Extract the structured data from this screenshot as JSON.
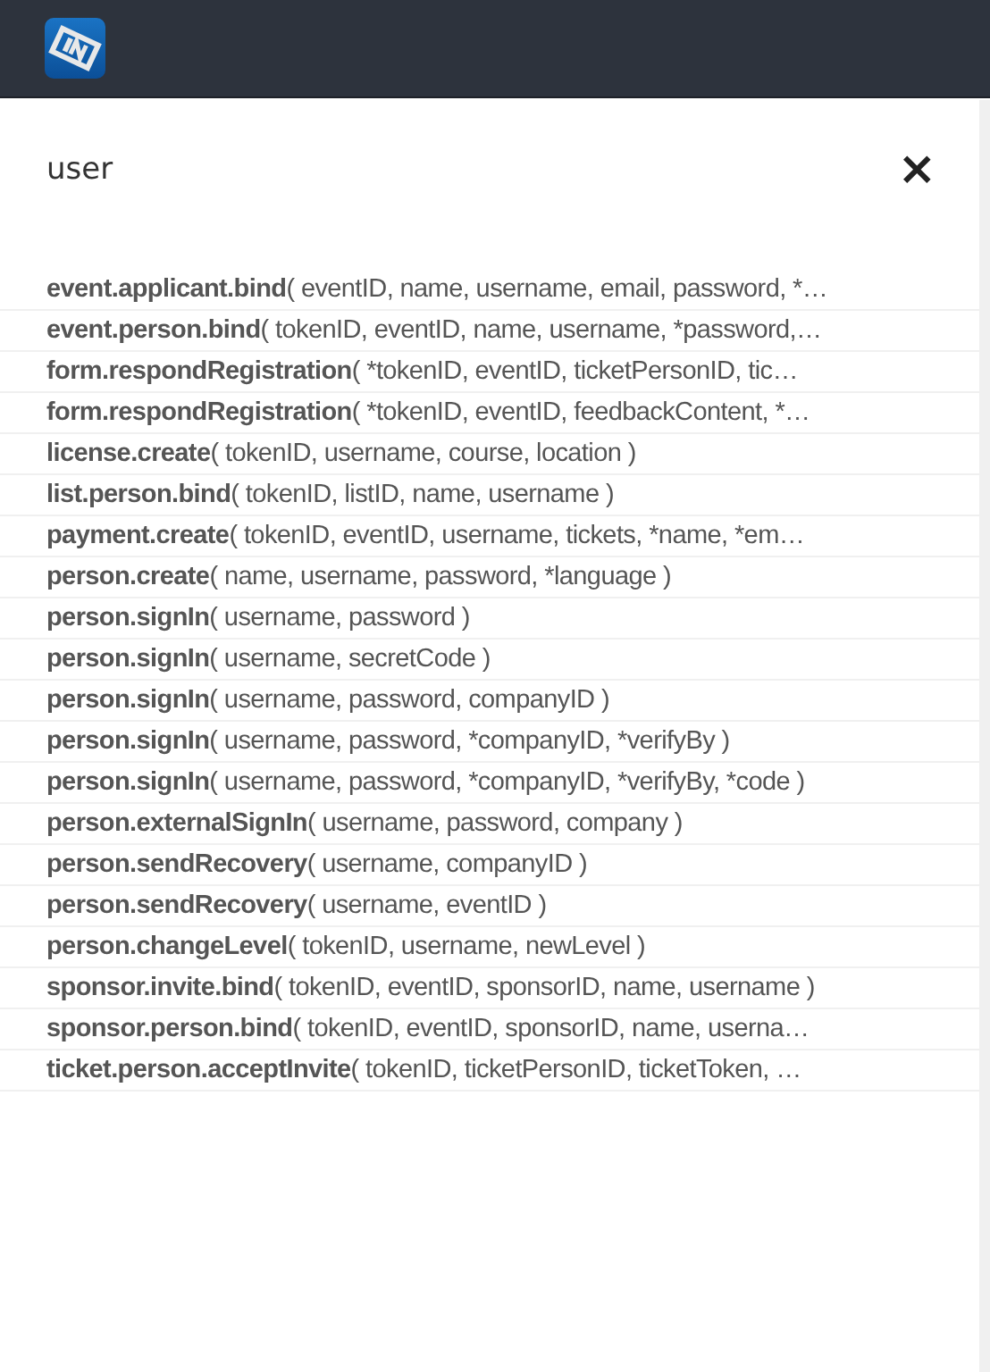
{
  "header": {
    "logo": {
      "kind": "logo"
    }
  },
  "search": {
    "value": "user",
    "close": "×"
  },
  "results": [
    {
      "text": "**event.applicant.bind**( eventID, name, username, email, password, *…"
    },
    {
      "text": "**event.person.bind**( tokenID, eventID, name, username, *password,…"
    },
    {
      "text": "**form.respondRegistration**( *tokenID, eventID, ticketPersonID, tic…"
    },
    {
      "text": "**form.respondRegistration**( *tokenID, eventID, feedbackContent, *…"
    },
    {
      "text": "**license.create**( tokenID, username, course, location )"
    },
    {
      "text": "**list.person.bind**( tokenID, listID, name, username )"
    },
    {
      "text": "**payment.create**( tokenID, eventID, username, tickets, *name, *em…"
    },
    {
      "text": "**person.create**( name, username, password, *language )"
    },
    {
      "text": "**person.signIn**( username, password )"
    },
    {
      "text": "**person.signIn**( username, secretCode )"
    },
    {
      "text": "**person.signIn**( username, password, companyID )"
    },
    {
      "text": "**person.signIn**( username, password, *companyID, *verifyBy )"
    },
    {
      "text": "**person.signIn**( username, password, *companyID, *verifyBy, *code )"
    },
    {
      "text": "**person.externalSignIn**( username, password, company )"
    },
    {
      "text": "**person.sendRecovery**( username, companyID )"
    },
    {
      "text": "**person.sendRecovery**( username, eventID )"
    },
    {
      "text": "**person.changeLevel**( tokenID, username, newLevel )"
    },
    {
      "text": "**sponsor.invite.bind**( tokenID, eventID, sponsorID, name, username )"
    },
    {
      "text": "**sponsor.person.bind**( tokenID, eventID, sponsorID, name, userna…"
    },
    {
      "text": "**ticket.person.acceptInvite**( tokenID, ticketPersonID, ticketToken, …"
    }
  ]
}
